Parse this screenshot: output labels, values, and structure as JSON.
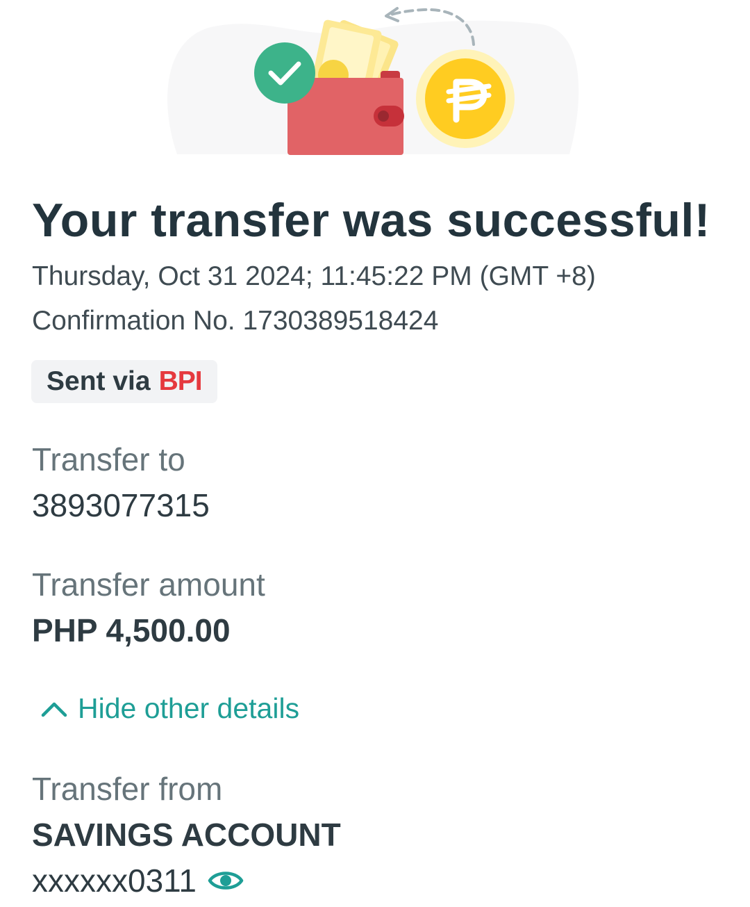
{
  "colors": {
    "accent_teal": "#1e9e96",
    "bpi_red": "#e5393e",
    "check_green": "#3db38a",
    "coin_yellow": "#ffcc21",
    "wallet_red": "#e16366"
  },
  "header": {
    "illustration_icons": [
      "check-icon",
      "wallet-icon",
      "peso-coin-icon",
      "arrow-icon"
    ],
    "title": "Your transfer was successful!",
    "datetime": "Thursday, Oct 31 2024; 11:45:22 PM (GMT +8)",
    "confirmation": "Confirmation No. 1730389518424"
  },
  "channel": {
    "prefix": "Sent via",
    "bank": "BPI"
  },
  "details": {
    "transfer_to_label": "Transfer to",
    "transfer_to_value": "3893077315",
    "amount_label": "Transfer amount",
    "amount_value": "PHP 4,500.00",
    "toggle_label": "Hide other details",
    "from_label": "Transfer from",
    "from_account_type": "SAVINGS ACCOUNT",
    "from_account_number": "xxxxxx0311"
  }
}
